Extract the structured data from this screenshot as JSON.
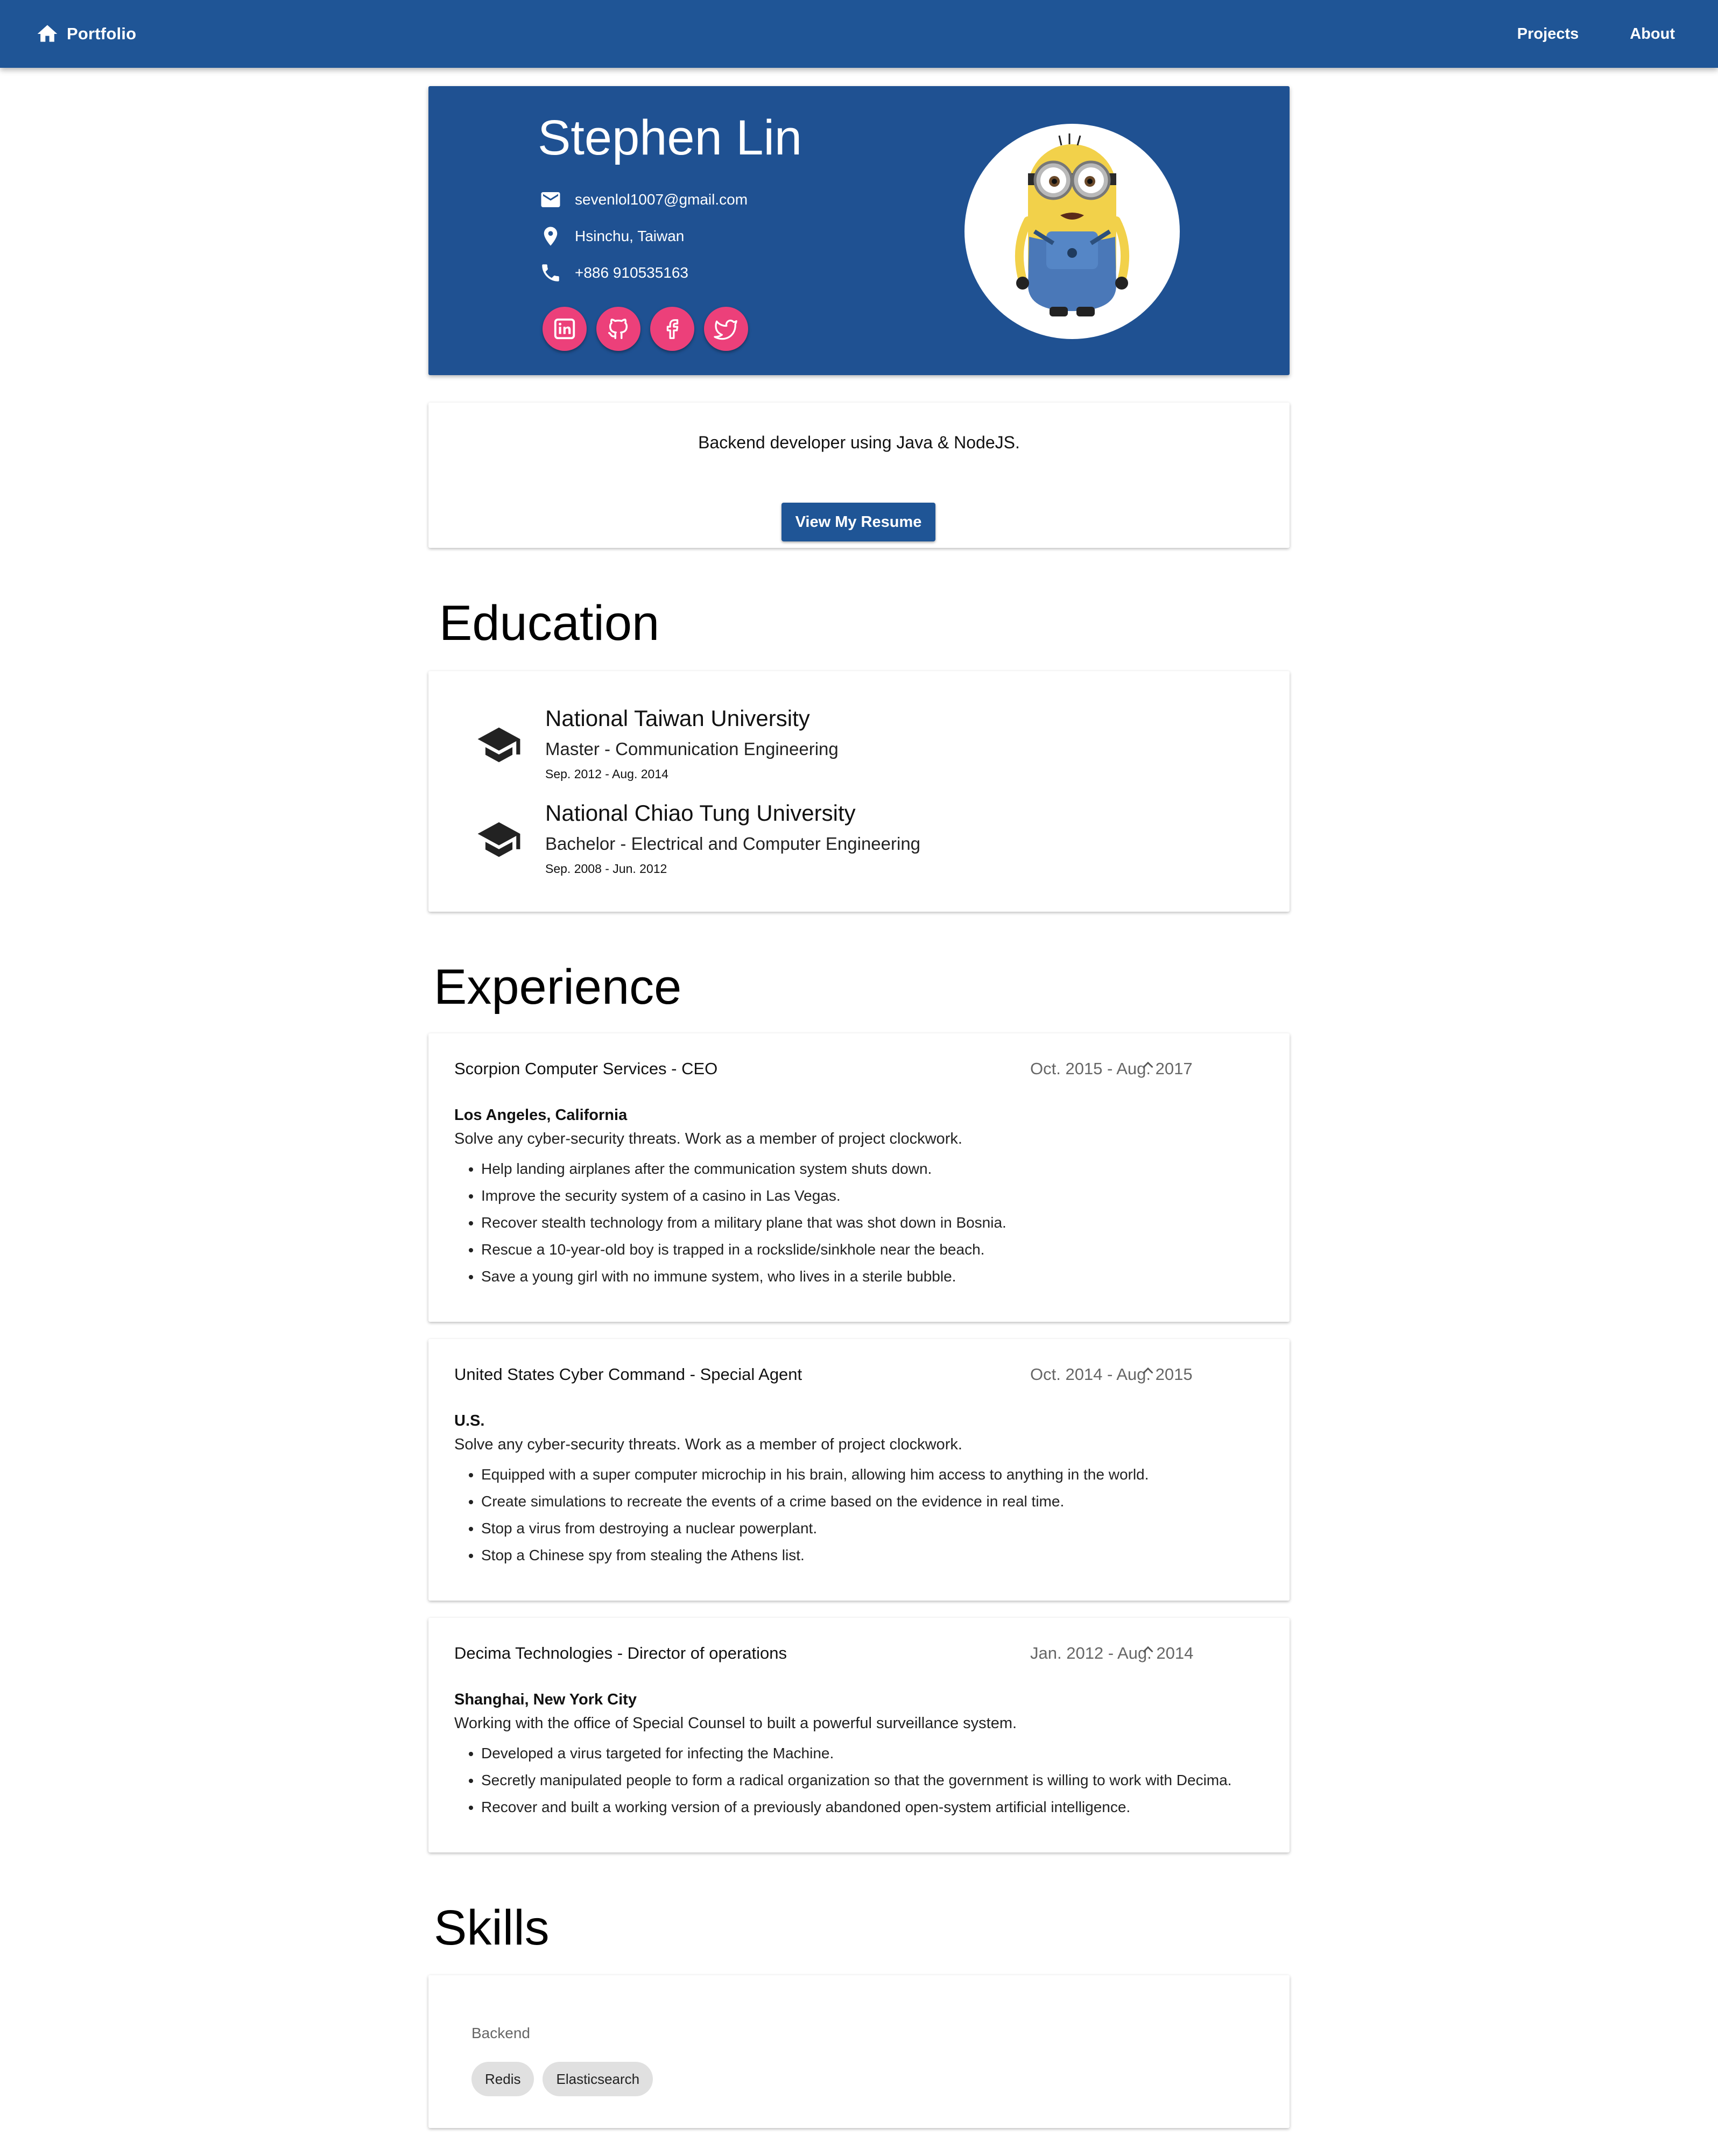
{
  "nav": {
    "brand": "Portfolio",
    "links": [
      "Projects",
      "About"
    ]
  },
  "profile": {
    "name": "Stephen Lin",
    "email": "sevenlol1007@gmail.com",
    "location": "Hsinchu, Taiwan",
    "phone": "+886 910535163",
    "socials": [
      "linkedin-icon",
      "github-icon",
      "facebook-icon",
      "twitter-icon"
    ],
    "avatar": "minion-avatar"
  },
  "summary": {
    "bio": "Backend developer using Java & NodeJS.",
    "button": "View My Resume"
  },
  "education": {
    "title": "Education",
    "items": [
      {
        "school": "National Taiwan University",
        "degree": "Master - Communication Engineering",
        "dates": "Sep. 2012 - Aug. 2014"
      },
      {
        "school": "National Chiao Tung University",
        "degree": "Bachelor - Electrical and Computer Engineering",
        "dates": "Sep. 2008 - Jun. 2012"
      }
    ]
  },
  "experience": {
    "title": "Experience",
    "items": [
      {
        "role": "Scorpion Computer Services - CEO",
        "dates": "Oct. 2015 - Aug. 2017",
        "location": "Los Angeles, California",
        "description": "Solve any cyber-security threats. Work as a member of project clockwork.",
        "bullets": [
          "Help landing airplanes after the communication system shuts down.",
          "Improve the security system of a casino in Las Vegas.",
          "Recover stealth technology from a military plane that was shot down in Bosnia.",
          "Rescue a 10-year-old boy is trapped in a rockslide/sinkhole near the beach.",
          "Save a young girl with no immune system, who lives in a sterile bubble."
        ]
      },
      {
        "role": "United States Cyber Command - Special Agent",
        "dates": "Oct. 2014 - Aug. 2015",
        "location": "U.S.",
        "description": "Solve any cyber-security threats. Work as a member of project clockwork.",
        "bullets": [
          "Equipped with a super computer microchip in his brain, allowing him access to anything in the world.",
          "Create simulations to recreate the events of a crime based on the evidence in real time.",
          "Stop a virus from destroying a nuclear powerplant.",
          "Stop a Chinese spy from stealing the Athens list."
        ]
      },
      {
        "role": "Decima Technologies - Director of operations",
        "dates": "Jan. 2012 - Aug. 2014",
        "location": "Shanghai, New York City",
        "description": "Working with the office of Special Counsel to built a powerful surveillance system.",
        "bullets": [
          "Developed a virus targeted for infecting the Machine.",
          "Secretly manipulated people to form a radical organization so that the government is willing to work with Decima.",
          "Recover and built a working version of a previously abandoned open-system artificial intelligence."
        ]
      }
    ]
  },
  "skills": {
    "title": "Skills",
    "group": "Backend",
    "chips": [
      "Redis",
      "Elasticsearch"
    ]
  },
  "colors": {
    "primary": "#1f5596",
    "accent": "#ec407a"
  }
}
